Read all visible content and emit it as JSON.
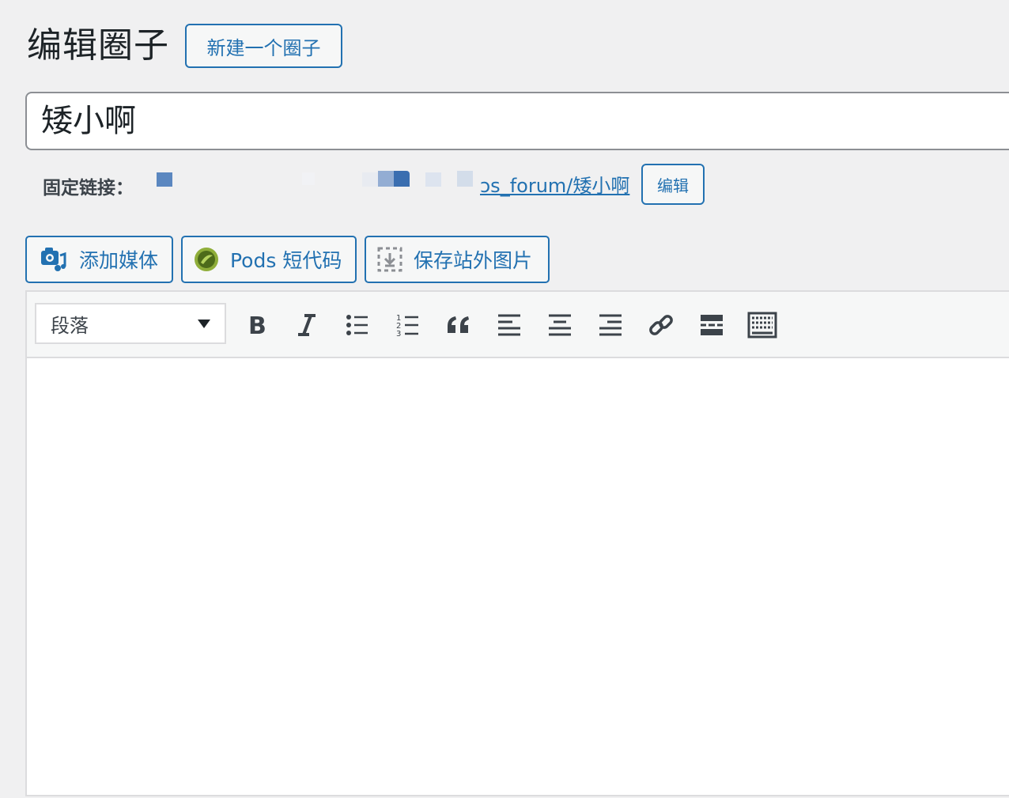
{
  "page": {
    "title": "编辑圈子",
    "new_button": "新建一个圈子"
  },
  "post_title": {
    "value": "矮小啊"
  },
  "permalink": {
    "label": "固定链接：",
    "url_visible": "ɔs_forum/矮小啊",
    "edit_button": "编辑"
  },
  "media_buttons": {
    "add_media": "添加媒体",
    "pods_shortcode": "Pods 短代码",
    "save_external_images": "保存站外图片"
  },
  "toolbar": {
    "format_value": "段落",
    "buttons": [
      "bold-icon",
      "italic-icon",
      "bullet-list-icon",
      "numbered-list-icon",
      "blockquote-icon",
      "align-left-icon",
      "align-center-icon",
      "align-right-icon",
      "link-icon",
      "read-more-icon",
      "toolbar-toggle-icon"
    ]
  },
  "colors": {
    "accent": "#2271b1",
    "background": "#f0f0f1",
    "text": "#1d2327"
  }
}
